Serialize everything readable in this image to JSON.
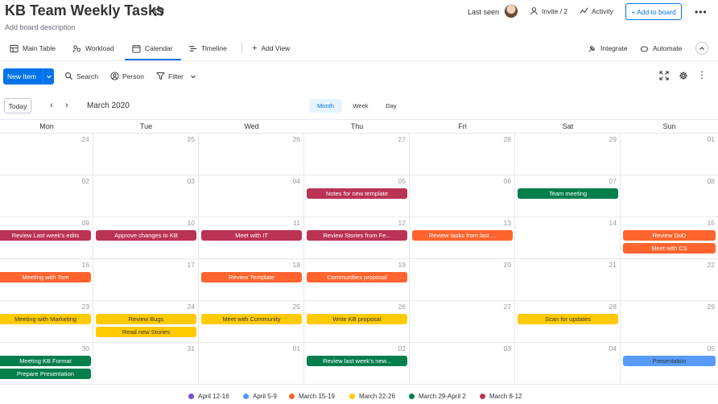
{
  "header": {
    "title": "KB Team Weekly Tasks",
    "description": "Add board description",
    "last_seen_label": "Last seen",
    "invite_label": "Invite / 2",
    "activity_label": "Activity",
    "add_to_board_label": "+ Add to board"
  },
  "views": {
    "main_table": "Main Table",
    "workload": "Workload",
    "calendar": "Calendar",
    "timeline": "Timeline",
    "add_view": "Add View",
    "integrate": "Integrate",
    "automate": "Automate"
  },
  "toolbar": {
    "new_item": "New Item",
    "search": "Search",
    "person": "Person",
    "filter": "Filter"
  },
  "calendar": {
    "today": "Today",
    "month_title": "March 2020",
    "modes": [
      "Month",
      "Week",
      "Day"
    ],
    "active_mode": "Month",
    "weekdays": [
      "Mon",
      "Tue",
      "Wed",
      "Thu",
      "Fri",
      "Sat",
      "Sun"
    ],
    "weeks": [
      [
        "24",
        "25",
        "26",
        "27",
        "28",
        "29",
        "01"
      ],
      [
        "02",
        "03",
        "04",
        "05",
        "06",
        "07",
        "08"
      ],
      [
        "09",
        "10",
        "11",
        "12",
        "13",
        "14",
        "15"
      ],
      [
        "16",
        "17",
        "18",
        "19",
        "20",
        "21",
        "22"
      ],
      [
        "23",
        "24",
        "25",
        "26",
        "27",
        "28",
        "29"
      ],
      [
        "30",
        "31",
        "01",
        "02",
        "03",
        "04",
        "05"
      ]
    ],
    "events": [
      {
        "week": 1,
        "day": 3,
        "slot": 0,
        "label": "Notes for new template",
        "color": "#bb3354",
        "text_color": "#ffffff"
      },
      {
        "week": 1,
        "day": 5,
        "slot": 0,
        "label": "Team meeting",
        "color": "#037f4c",
        "text_color": "#ffffff"
      },
      {
        "week": 2,
        "day": 0,
        "slot": 0,
        "label": "Review Last week's edits",
        "color": "#bb3354",
        "text_color": "#ffffff"
      },
      {
        "week": 2,
        "day": 1,
        "slot": 0,
        "label": "Approve changes to KB",
        "color": "#bb3354",
        "text_color": "#ffffff"
      },
      {
        "week": 2,
        "day": 2,
        "slot": 0,
        "label": "Meet with IT",
        "color": "#bb3354",
        "text_color": "#ffffff"
      },
      {
        "week": 2,
        "day": 3,
        "slot": 0,
        "label": "Review Stories from Fe...",
        "color": "#bb3354",
        "text_color": "#ffffff"
      },
      {
        "week": 2,
        "day": 4,
        "slot": 0,
        "label": "Review tasks from last ...",
        "color": "#ff642e",
        "text_color": "#ffffff"
      },
      {
        "week": 2,
        "day": 6,
        "slot": 0,
        "label": "Review DoD",
        "color": "#ff642e",
        "text_color": "#ffffff"
      },
      {
        "week": 2,
        "day": 6,
        "slot": 1,
        "label": "Meet with CS",
        "color": "#ff642e",
        "text_color": "#ffffff"
      },
      {
        "week": 3,
        "day": 0,
        "slot": 0,
        "label": "Meeting with Tom",
        "color": "#ff642e",
        "text_color": "#ffffff"
      },
      {
        "week": 3,
        "day": 2,
        "slot": 0,
        "label": "Review Template",
        "color": "#ff642e",
        "text_color": "#ffffff"
      },
      {
        "week": 3,
        "day": 3,
        "slot": 0,
        "label": "Communities proposal",
        "color": "#ff642e",
        "text_color": "#ffffff"
      },
      {
        "week": 4,
        "day": 0,
        "slot": 0,
        "label": "Meeting with Marketing",
        "color": "#ffcb00",
        "text_color": "#323338"
      },
      {
        "week": 4,
        "day": 1,
        "slot": 0,
        "label": "Review Bugs",
        "color": "#ffcb00",
        "text_color": "#323338"
      },
      {
        "week": 4,
        "day": 1,
        "slot": 1,
        "label": "Read new Stories",
        "color": "#ffcb00",
        "text_color": "#323338"
      },
      {
        "week": 4,
        "day": 2,
        "slot": 0,
        "label": "Meet with Community",
        "color": "#ffcb00",
        "text_color": "#323338"
      },
      {
        "week": 4,
        "day": 3,
        "slot": 0,
        "label": "Write KB proposal",
        "color": "#ffcb00",
        "text_color": "#323338"
      },
      {
        "week": 4,
        "day": 5,
        "slot": 0,
        "label": "Scan for updates",
        "color": "#ffcb00",
        "text_color": "#323338"
      },
      {
        "week": 5,
        "day": 0,
        "slot": 0,
        "label": "Meeting KB Format",
        "color": "#037f4c",
        "text_color": "#ffffff"
      },
      {
        "week": 5,
        "day": 0,
        "slot": 1,
        "label": "Prepare Presentation",
        "color": "#037f4c",
        "text_color": "#ffffff"
      },
      {
        "week": 5,
        "day": 3,
        "slot": 0,
        "label": "Review last week's new...",
        "color": "#037f4c",
        "text_color": "#ffffff"
      },
      {
        "week": 5,
        "day": 6,
        "slot": 0,
        "label": "Presentation",
        "color": "#579bfc",
        "text_color": "#323338"
      }
    ]
  },
  "legend": [
    {
      "label": "April 12-16",
      "color": "#784bd1"
    },
    {
      "label": "April 5-9",
      "color": "#579bfc"
    },
    {
      "label": "March 15-19",
      "color": "#ff642e"
    },
    {
      "label": "March 22-26",
      "color": "#ffcb00"
    },
    {
      "label": "March 29-April 2",
      "color": "#037f4c"
    },
    {
      "label": "March 8-12",
      "color": "#bb3354"
    }
  ]
}
